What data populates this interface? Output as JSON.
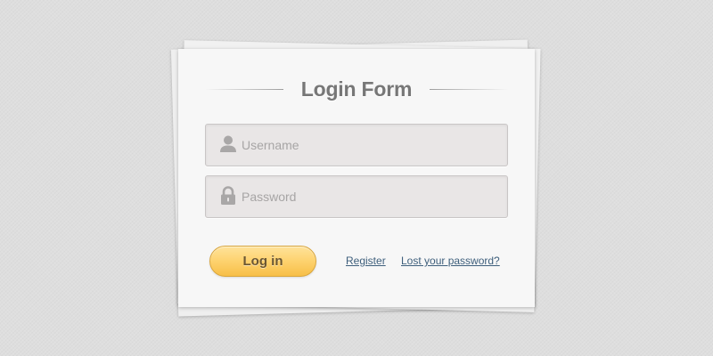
{
  "login_form": {
    "title": "Login Form",
    "username": {
      "placeholder": "Username",
      "value": "",
      "icon": "user-icon"
    },
    "password": {
      "placeholder": "Password",
      "value": "",
      "icon": "lock-icon"
    },
    "login_button_label": "Log in",
    "register_link": "Register",
    "lost_password_link": "Lost your password?"
  },
  "colors": {
    "background": "#dedede",
    "card": "#f7f7f7",
    "field_background": "#e9e6e6",
    "button_gradient_top": "#ffe39a",
    "button_gradient_bottom": "#f7bf48",
    "link": "#3e5f7c",
    "title": "#777777"
  }
}
